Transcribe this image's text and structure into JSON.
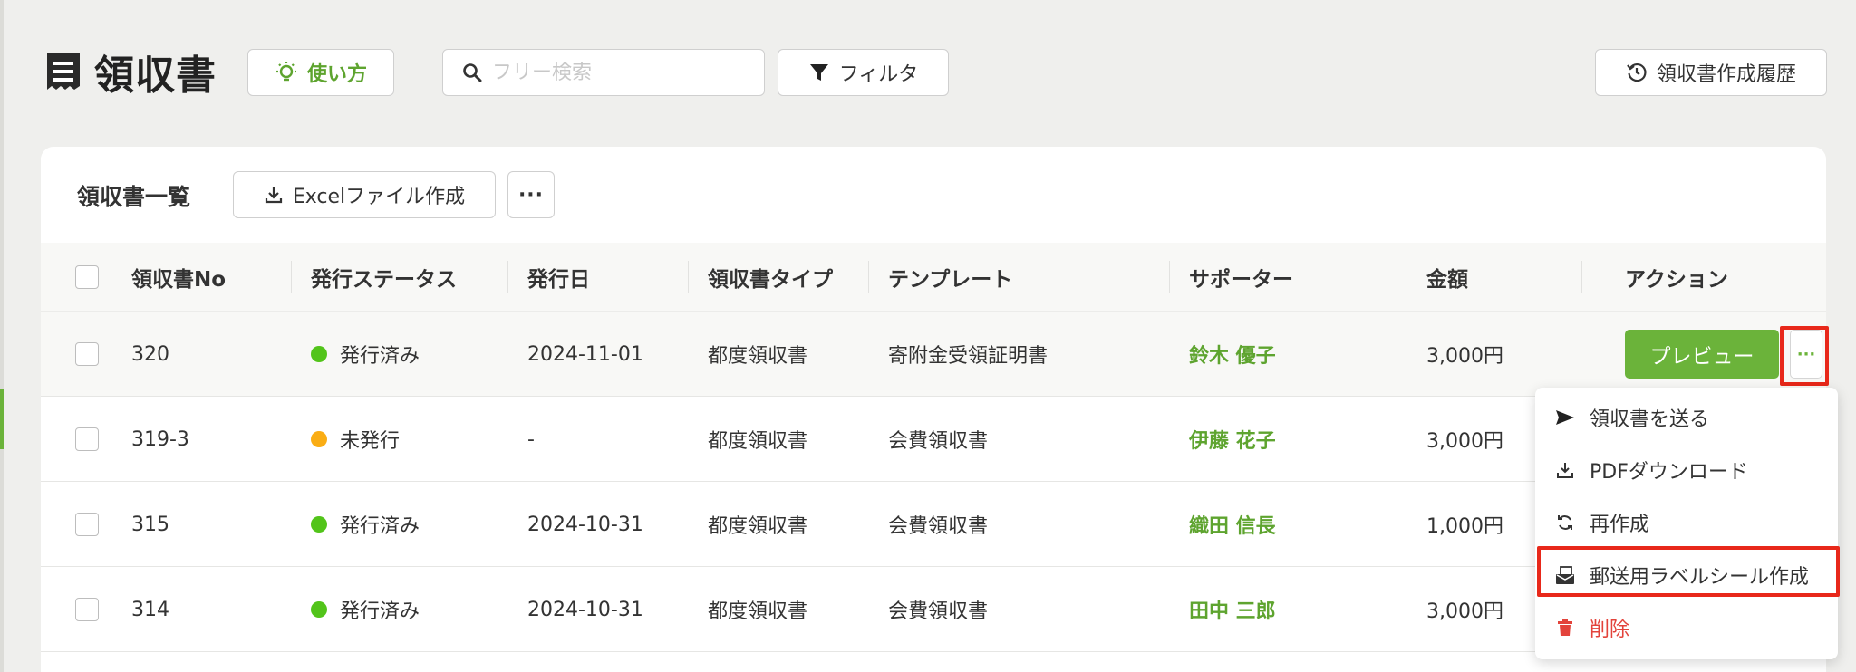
{
  "header": {
    "title": "領収書",
    "howto_label": "使い方",
    "search_placeholder": "フリー検索",
    "filter_label": "フィルタ",
    "history_label": "領収書作成履歴"
  },
  "card": {
    "title": "領収書一覧",
    "excel_label": "Excelファイル作成",
    "more_label": "···"
  },
  "table": {
    "columns": [
      "領収書No",
      "発行ステータス",
      "発行日",
      "領収書タイプ",
      "テンプレート",
      "サポーター",
      "金額",
      "アクション"
    ],
    "rows": [
      {
        "no": "320",
        "status": "発行済み",
        "status_color": "#52c41a",
        "date": "2024-11-01",
        "type": "都度領収書",
        "template": "寄附金受領証明書",
        "supporter": "鈴木 優子",
        "amount": "3,000円"
      },
      {
        "no": "319-3",
        "status": "未発行",
        "status_color": "#faad14",
        "date": "-",
        "type": "都度領収書",
        "template": "会費領収書",
        "supporter": "伊藤 花子",
        "amount": "3,000円"
      },
      {
        "no": "315",
        "status": "発行済み",
        "status_color": "#52c41a",
        "date": "2024-10-31",
        "type": "都度領収書",
        "template": "会費領収書",
        "supporter": "織田 信長",
        "amount": "1,000円"
      },
      {
        "no": "314",
        "status": "発行済み",
        "status_color": "#52c41a",
        "date": "2024-10-31",
        "type": "都度領収書",
        "template": "会費領収書",
        "supporter": "田中 三郎",
        "amount": "3,000円"
      }
    ],
    "preview_label": "プレビュー",
    "row_more_label": "···"
  },
  "menu": {
    "items": [
      {
        "label": "領収書を送る",
        "icon": "send-icon"
      },
      {
        "label": "PDFダウンロード",
        "icon": "download-icon"
      },
      {
        "label": "再作成",
        "icon": "refresh-icon"
      },
      {
        "label": "郵送用ラベルシール作成",
        "icon": "mail-label-icon"
      },
      {
        "label": "削除",
        "icon": "trash-icon"
      }
    ]
  },
  "colors": {
    "accent": "#6bb33a",
    "danger": "#e3433b",
    "highlight": "#e8281a",
    "issued": "#52c41a",
    "unissued": "#faad14"
  }
}
